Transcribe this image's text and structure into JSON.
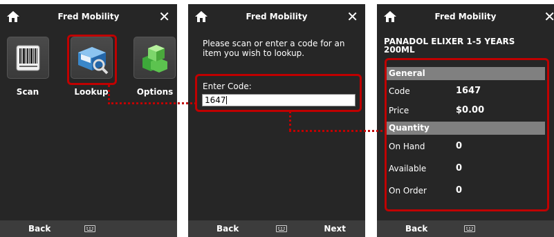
{
  "screens": [
    {
      "title": "Fred Mobility",
      "apps": [
        {
          "label": "Scan",
          "icon": "barcode-icon"
        },
        {
          "label": "Lookup",
          "icon": "lookup-box-icon"
        },
        {
          "label": "Options",
          "icon": "options-cubes-icon"
        }
      ],
      "bottom": {
        "back": "Back"
      }
    },
    {
      "title": "Fred Mobility",
      "instruction": "Please scan or enter a code for an item you wish to lookup.",
      "code_label": "Enter Code:",
      "code_value": "1647",
      "bottom": {
        "back": "Back",
        "next": "Next"
      }
    },
    {
      "title": "Fred Mobility",
      "product_name": "PANADOL ELIXER 1-5 YEARS 200ML",
      "general": {
        "header": "General",
        "code_label": "Code",
        "code_value": "1647",
        "price_label": "Price",
        "price_value": "$0.00"
      },
      "quantity": {
        "header": "Quantity",
        "on_hand_label": "On Hand",
        "on_hand_value": "0",
        "available_label": "Available",
        "available_value": "0",
        "on_order_label": "On Order",
        "on_order_value": "0"
      },
      "bottom": {
        "back": "Back"
      }
    }
  ],
  "colors": {
    "highlight": "#c00000",
    "background": "#262626",
    "section": "#808080"
  }
}
